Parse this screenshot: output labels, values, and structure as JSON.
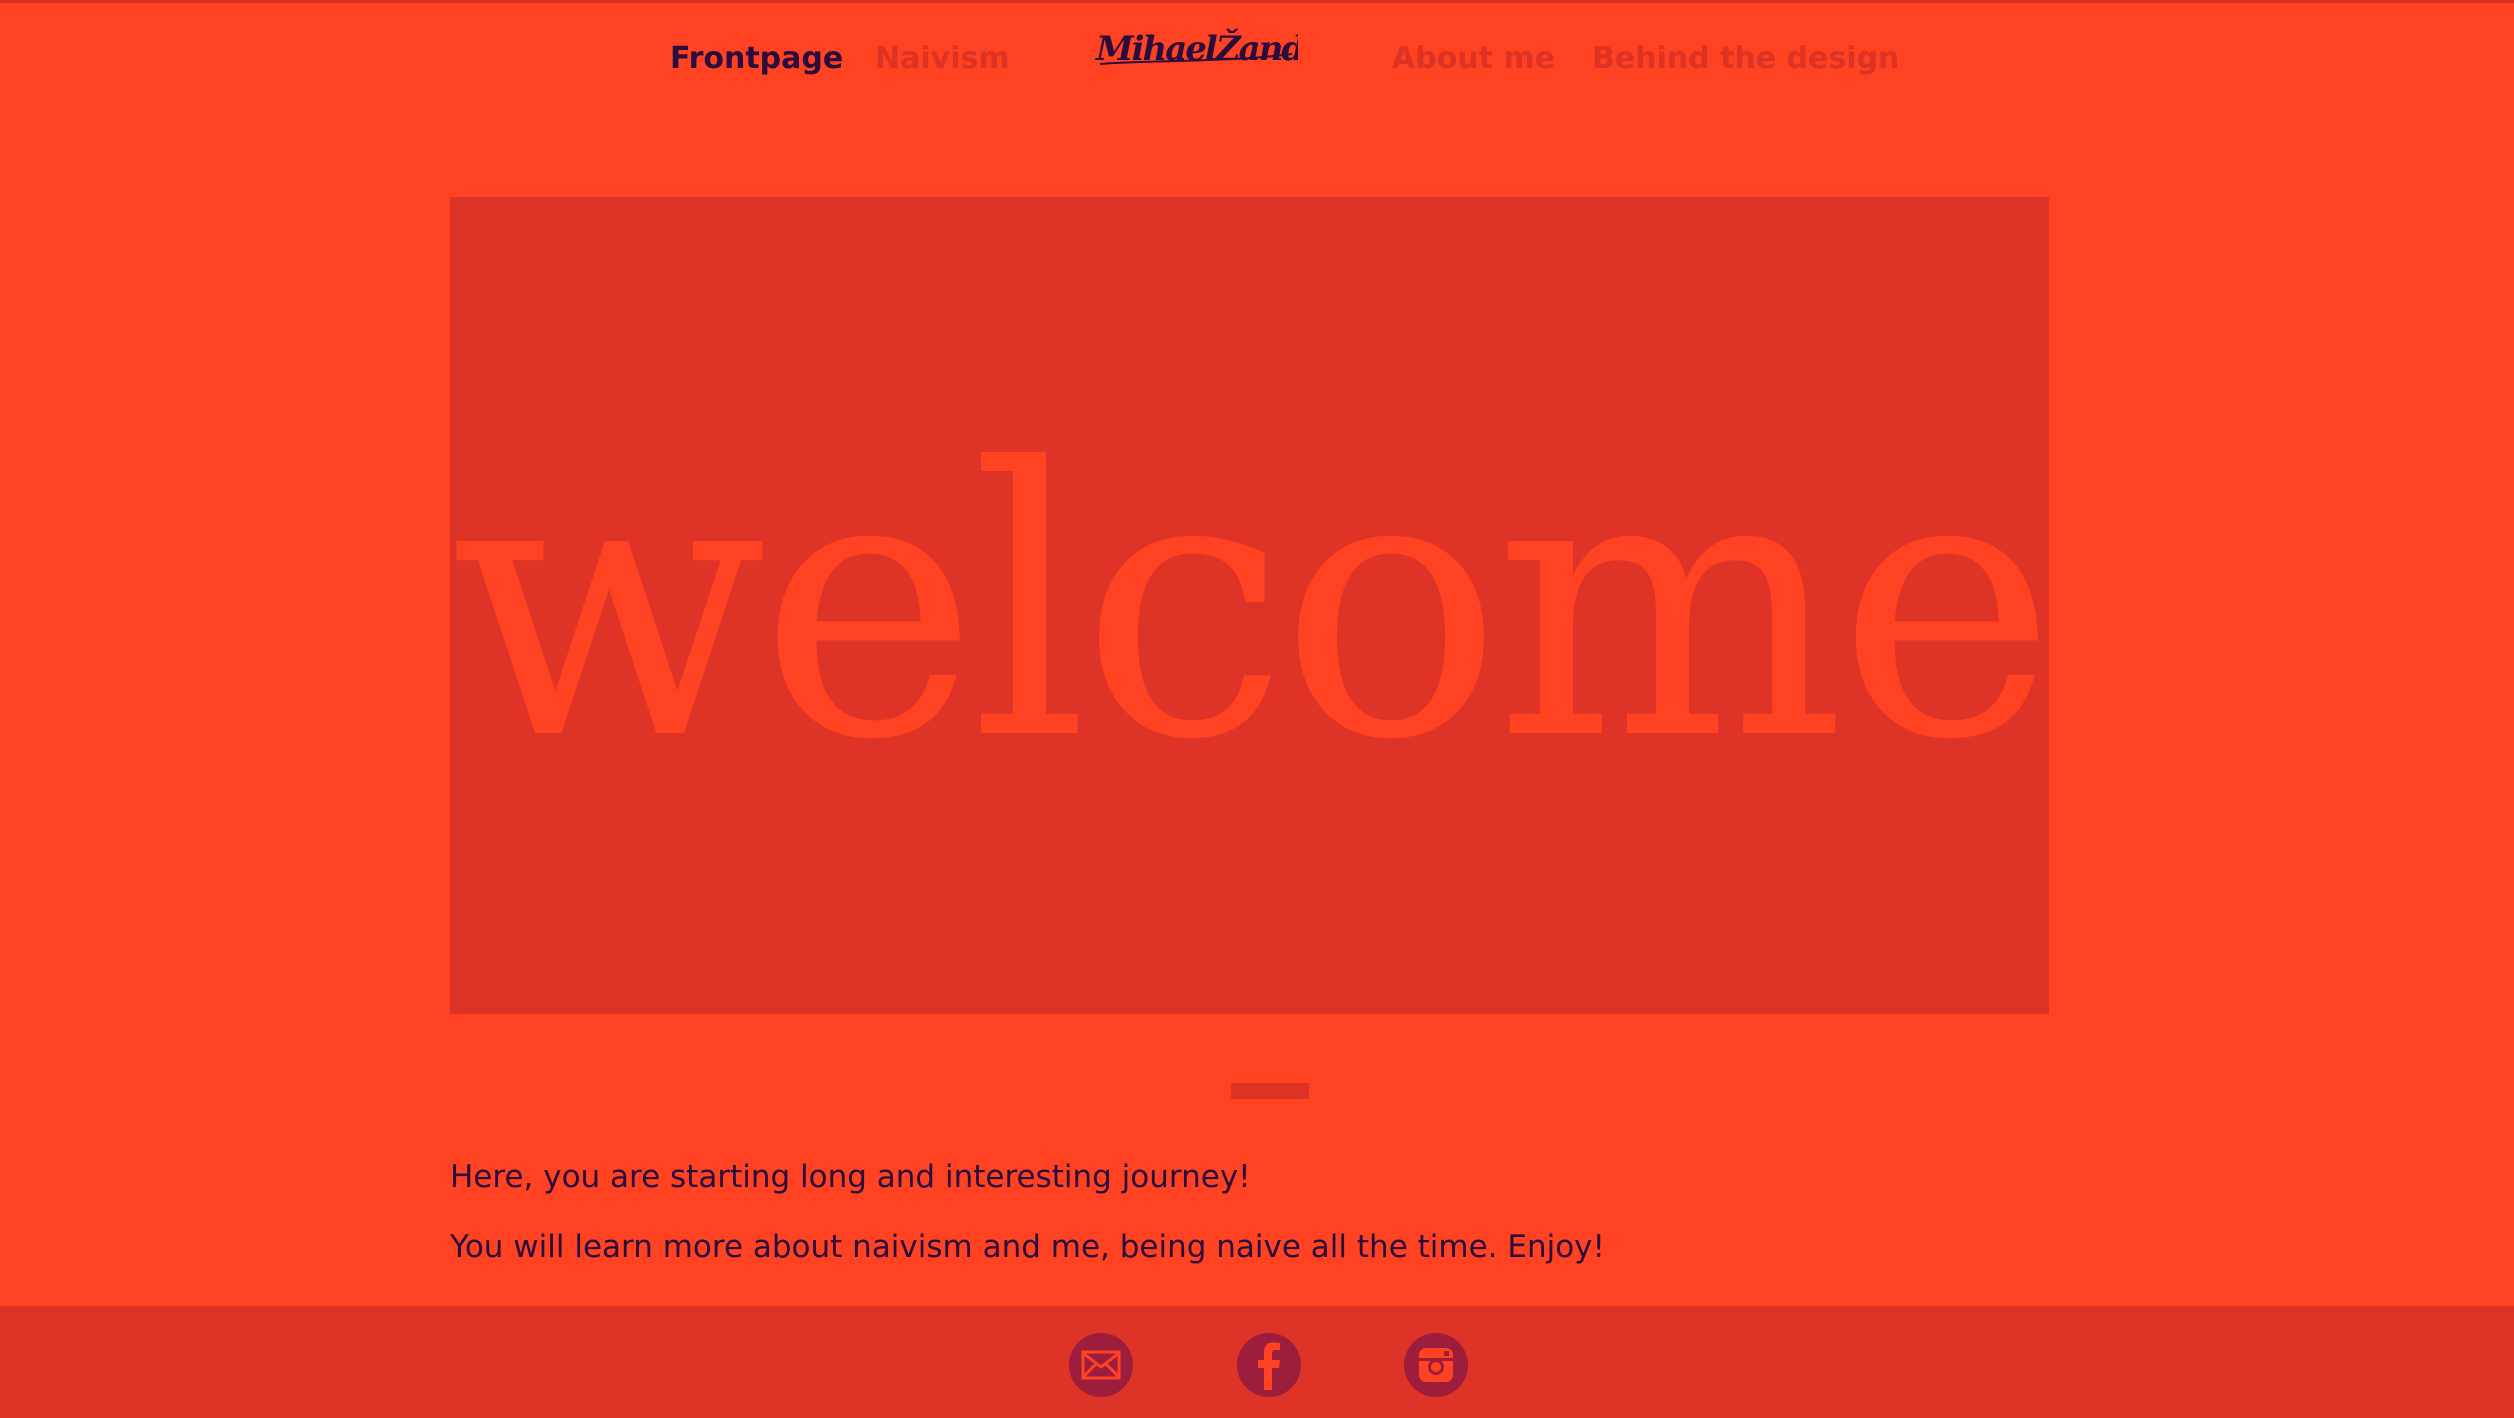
{
  "nav": {
    "items": [
      {
        "label": "Frontpage",
        "active": true
      },
      {
        "label": "Naivism",
        "active": false
      },
      {
        "label": "About me",
        "active": false
      },
      {
        "label": "Behind the design",
        "active": false
      }
    ],
    "logo_text": "MihaelŽandro"
  },
  "hero": {
    "text": "welcome"
  },
  "intro": {
    "line1": "Here, you are starting long and interesting journey!",
    "line2": "You will learn more about naivism and me, being naive all the time. Enjoy!"
  },
  "footer": {
    "icons": [
      "mail-icon",
      "facebook-icon",
      "instagram-icon"
    ]
  },
  "colors": {
    "background": "#ff4221",
    "panel": "#de3327",
    "muted_link": "#dc3325",
    "text_dark": "#2a0c3d",
    "icon_circle": "#9c1d3c"
  }
}
